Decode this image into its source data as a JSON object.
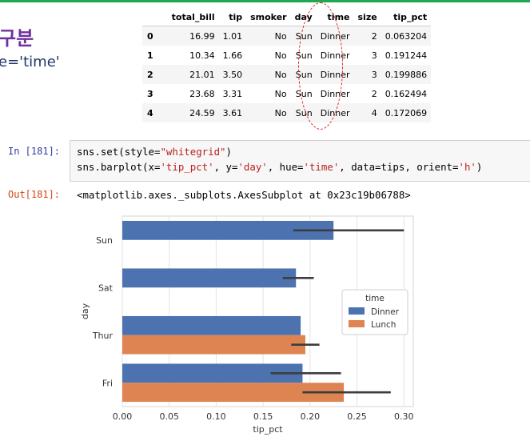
{
  "slide": {
    "title": "구분",
    "subtitle": "e='time'",
    "accent_color": "#1fa84f",
    "title_color": "#7030a0"
  },
  "dataframe": {
    "columns": [
      "",
      "total_bill",
      "tip",
      "smoker",
      "day",
      "time",
      "size",
      "tip_pct"
    ],
    "rows": [
      [
        "0",
        "16.99",
        "1.01",
        "No",
        "Sun",
        "Dinner",
        "2",
        "0.063204"
      ],
      [
        "1",
        "10.34",
        "1.66",
        "No",
        "Sun",
        "Dinner",
        "3",
        "0.191244"
      ],
      [
        "2",
        "21.01",
        "3.50",
        "No",
        "Sun",
        "Dinner",
        "3",
        "0.199886"
      ],
      [
        "3",
        "23.68",
        "3.31",
        "No",
        "Sun",
        "Dinner",
        "2",
        "0.162494"
      ],
      [
        "4",
        "24.59",
        "3.61",
        "No",
        "Sun",
        "Dinner",
        "4",
        "0.172069"
      ]
    ]
  },
  "cell": {
    "in_prompt": "In [181]:",
    "out_prompt": "Out[181]:",
    "code": {
      "line1": {
        "fn": "sns.set(",
        "arg": "style=",
        "str": "\"whitegrid\"",
        "end": ")"
      },
      "line2": {
        "fn": "sns.barplot(",
        "p1": "x=",
        "s1": "'tip_pct'",
        "p2": ", y=",
        "s2": "'day'",
        "p3": ", hue=",
        "s3": "'time'",
        "p4": ", data=tips, orient=",
        "s4": "'h'",
        "end": ")"
      }
    },
    "output": "<matplotlib.axes._subplots.AxesSubplot at 0x23c19b06788>"
  },
  "chart_data": {
    "type": "bar",
    "orientation": "horizontal",
    "categories": [
      "Sun",
      "Sat",
      "Thur",
      "Fri"
    ],
    "series": [
      {
        "name": "Dinner",
        "color": "#4c72b0",
        "values": [
          0.225,
          0.185,
          0.19,
          0.192
        ],
        "ci": [
          [
            0.182,
            0.3
          ],
          [
            0.171,
            0.204
          ],
          null,
          [
            0.158,
            0.233
          ]
        ]
      },
      {
        "name": "Lunch",
        "color": "#dd8452",
        "values": [
          null,
          null,
          0.195,
          0.236
        ],
        "ci": [
          null,
          null,
          [
            0.18,
            0.21
          ],
          [
            0.192,
            0.286
          ]
        ]
      }
    ],
    "xlabel": "tip_pct",
    "ylabel": "day",
    "xlim": [
      0.0,
      0.31
    ],
    "xticks": [
      "0.00",
      "0.05",
      "0.10",
      "0.15",
      "0.20",
      "0.25",
      "0.30"
    ],
    "xtick_values": [
      0.0,
      0.05,
      0.1,
      0.15,
      0.2,
      0.25,
      0.3
    ],
    "grid": true,
    "legend": {
      "title": "time",
      "placement": "right",
      "entries": [
        "Dinner",
        "Lunch"
      ]
    }
  }
}
